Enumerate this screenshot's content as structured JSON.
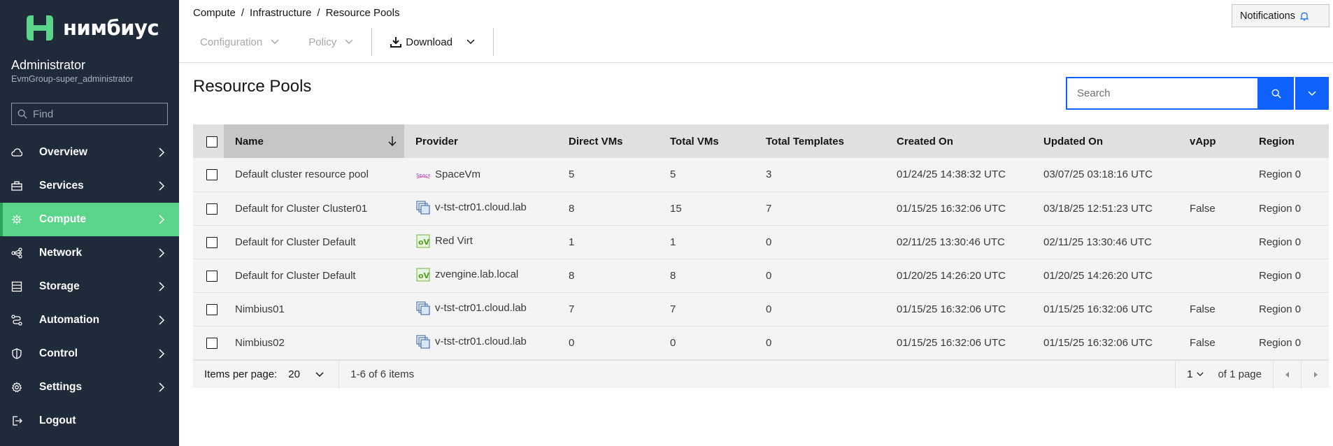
{
  "brand": {
    "name": "нимбиус",
    "color": "#5bd58a"
  },
  "user": {
    "name": "Administrator",
    "group": "EvmGroup-super_administrator"
  },
  "find": {
    "placeholder": "Find"
  },
  "nav": [
    {
      "label": "Overview",
      "icon": "cloud-icon"
    },
    {
      "label": "Services",
      "icon": "toolbox-icon"
    },
    {
      "label": "Compute",
      "icon": "chip-icon",
      "active": true
    },
    {
      "label": "Network",
      "icon": "network-icon"
    },
    {
      "label": "Storage",
      "icon": "storage-icon"
    },
    {
      "label": "Automation",
      "icon": "automation-icon"
    },
    {
      "label": "Control",
      "icon": "shield-icon"
    },
    {
      "label": "Settings",
      "icon": "gear-icon"
    },
    {
      "label": "Logout",
      "icon": "logout-icon"
    }
  ],
  "breadcrumb": [
    "Compute",
    "Infrastructure",
    "Resource Pools"
  ],
  "notifications": {
    "label": "Notifications"
  },
  "toolbar": {
    "configuration": "Configuration",
    "policy": "Policy",
    "download": "Download"
  },
  "page_title": "Resource Pools",
  "search": {
    "placeholder": "Search"
  },
  "table": {
    "headers": [
      "Name",
      "Provider",
      "Direct VMs",
      "Total VMs",
      "Total Templates",
      "Created On",
      "Updated On",
      "vApp",
      "Region"
    ],
    "rows": [
      {
        "name": "Default cluster resource pool",
        "provider": "SpaceVm",
        "provider_icon": "spacevm-icon",
        "direct_vms": "5",
        "total_vms": "5",
        "total_templates": "3",
        "created_on": "01/24/25 14:38:32 UTC",
        "updated_on": "03/07/25 03:18:16 UTC",
        "vapp": "",
        "region": "Region 0"
      },
      {
        "name": "Default for Cluster Cluster01",
        "provider": "v-tst-ctr01.cloud.lab",
        "provider_icon": "vmware-icon",
        "direct_vms": "8",
        "total_vms": "15",
        "total_templates": "7",
        "created_on": "01/15/25 16:32:06 UTC",
        "updated_on": "03/18/25 12:51:23 UTC",
        "vapp": "False",
        "region": "Region 0"
      },
      {
        "name": "Default for Cluster Default",
        "provider": "Red Virt",
        "provider_icon": "redvirt-icon",
        "direct_vms": "1",
        "total_vms": "1",
        "total_templates": "0",
        "created_on": "02/11/25 13:30:46 UTC",
        "updated_on": "02/11/25 13:30:46 UTC",
        "vapp": "",
        "region": "Region 0"
      },
      {
        "name": "Default for Cluster Default",
        "provider": "zvengine.lab.local",
        "provider_icon": "redvirt-icon",
        "direct_vms": "8",
        "total_vms": "8",
        "total_templates": "0",
        "created_on": "01/20/25 14:26:20 UTC",
        "updated_on": "01/20/25 14:26:20 UTC",
        "vapp": "",
        "region": "Region 0"
      },
      {
        "name": "Nimbius01",
        "provider": "v-tst-ctr01.cloud.lab",
        "provider_icon": "vmware-icon",
        "direct_vms": "7",
        "total_vms": "7",
        "total_templates": "0",
        "created_on": "01/15/25 16:32:06 UTC",
        "updated_on": "01/15/25 16:32:06 UTC",
        "vapp": "False",
        "region": "Region 0"
      },
      {
        "name": "Nimbius02",
        "provider": "v-tst-ctr01.cloud.lab",
        "provider_icon": "vmware-icon",
        "direct_vms": "0",
        "total_vms": "0",
        "total_templates": "0",
        "created_on": "01/15/25 16:32:06 UTC",
        "updated_on": "01/15/25 16:32:06 UTC",
        "vapp": "False",
        "region": "Region 0"
      }
    ]
  },
  "pagination": {
    "items_per_page_label": "Items per page:",
    "items_per_page": "20",
    "range": "1-6 of 6 items",
    "page": "1",
    "of_pages": "of 1 page"
  },
  "colors": {
    "sidebar": "#1f2b3a",
    "active": "#5bd58a",
    "primary": "#0f62fe"
  }
}
